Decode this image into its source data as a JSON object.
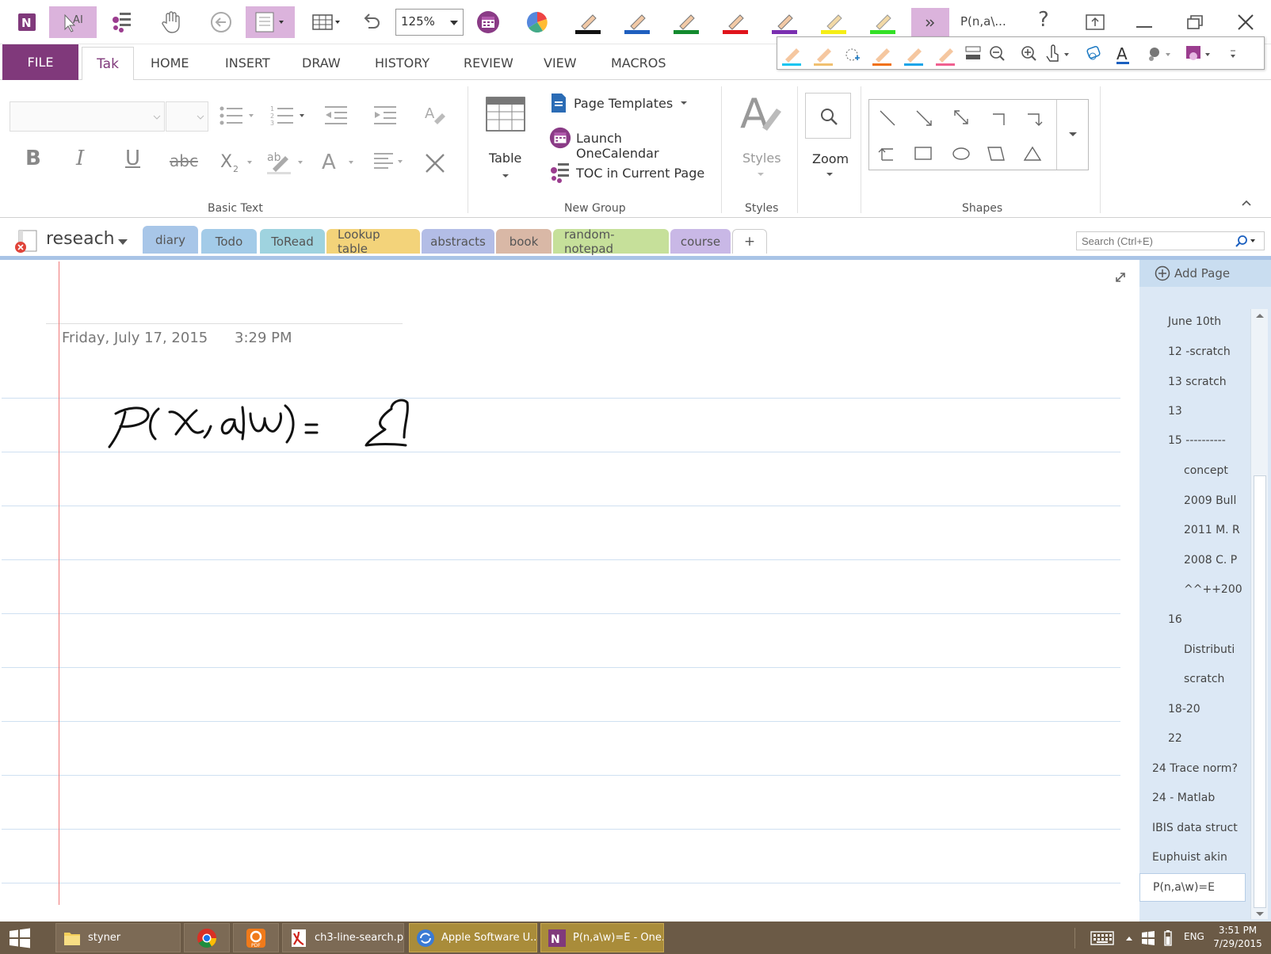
{
  "window": {
    "title": "P(n,a\\...",
    "zoom": "125%",
    "help": "?"
  },
  "ribbon_tabs": [
    "FILE",
    "Tak",
    "HOME",
    "INSERT",
    "DRAW",
    "HISTORY",
    "REVIEW",
    "VIEW",
    "MACROS"
  ],
  "ribbon": {
    "basic_text_label": "Basic Text",
    "table_label": "Table",
    "page_templates": "Page Templates",
    "launch_onecalendar": "Launch OneCalendar",
    "toc_in_current_page": "TOC in Current Page",
    "new_group_label": "New Group",
    "styles_button": "Styles",
    "styles_label": "Styles",
    "zoom_button": "Zoom",
    "shapes_label": "Shapes"
  },
  "notebook": {
    "name": "reseach",
    "sections": [
      {
        "label": "diary",
        "color": "#a8c6e8"
      },
      {
        "label": "Todo",
        "color": "#a3cbe8"
      },
      {
        "label": "ToRead",
        "color": "#9fd3df"
      },
      {
        "label": "Lookup table",
        "color": "#f3d37a"
      },
      {
        "label": "abstracts",
        "color": "#b3bde6"
      },
      {
        "label": "book",
        "color": "#d9b8a6"
      },
      {
        "label": "random-notepad",
        "color": "#c6e09a"
      },
      {
        "label": "course",
        "color": "#c9b8e6"
      }
    ],
    "add_section": "+",
    "search_placeholder": "Search (Ctrl+E)"
  },
  "page": {
    "date": "Friday, July 17, 2015",
    "time": "3:29 PM"
  },
  "page_list": {
    "add_page": "Add Page",
    "items": [
      "June 10th",
      "12 -scratch",
      "13 scratch",
      "13",
      "15 ----------",
      "concept",
      "2009 Bull",
      "2011 M. R",
      "2008 C. P",
      "^^++200",
      "16",
      "Distributi",
      "scratch",
      "18-20",
      "22",
      "24 Trace norm?",
      "24 - Matlab",
      "IBIS data struct",
      "Euphuist akin"
    ],
    "current": "P(n,a\\w)=E"
  },
  "taskbar": {
    "items": [
      "styner",
      "ch3-line-search.p...",
      "Apple Software U...",
      "P(n,a\\w)=E - One..."
    ],
    "language": "ENG",
    "time": "3:51 PM",
    "date": "7/29/2015"
  },
  "colors": {
    "accent": "#80397b",
    "page_rule": "#cfe0f1",
    "margin_line": "#f07878",
    "taskbar": "#6b5a46"
  }
}
